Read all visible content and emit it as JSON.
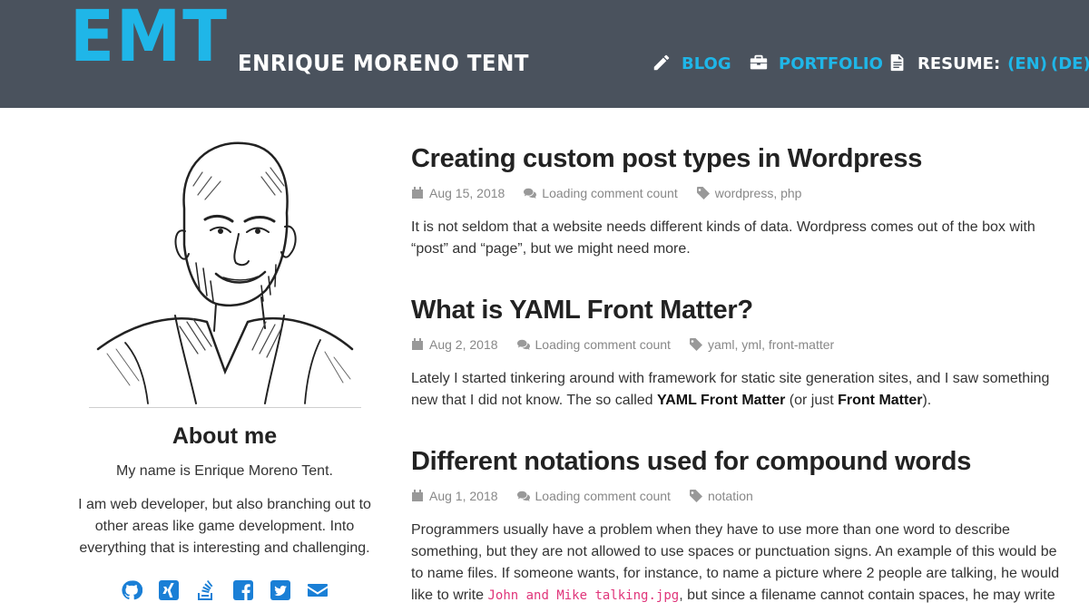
{
  "header": {
    "logo": "EMT",
    "site_name": "ENRIQUE MORENO TENT",
    "nav": {
      "blog": "BLOG",
      "portfolio": "PORTFOLIO",
      "resume_label": "RESUME:",
      "resume_en": "(EN)",
      "resume_de": "(DE)"
    }
  },
  "colors": {
    "header_bg": "#4a525d",
    "accent": "#1fb6e8",
    "social": "#1a7fd6",
    "code": "#e0357a"
  },
  "sidebar": {
    "about_title": "About me",
    "about_p1": "My name is Enrique Moreno Tent.",
    "about_p2": "I am web developer, but also branching out to other areas like game development. Into everything that is interesting and challenging.",
    "social_icons": [
      "github-icon",
      "xing-icon",
      "stackoverflow-icon",
      "facebook-icon",
      "twitter-icon",
      "email-icon"
    ]
  },
  "posts": [
    {
      "title": "Creating custom post types in Wordpress",
      "date": "Aug 15, 2018",
      "comments": "Loading comment count",
      "tags": "wordpress, php",
      "excerpt": "It is not seldom that a website needs different kinds of data. Wordpress comes out of the box with “post” and “page”, but we might need more."
    },
    {
      "title": "What is YAML Front Matter?",
      "date": "Aug 2, 2018",
      "comments": "Loading comment count",
      "tags": "yaml, yml, front-matter",
      "excerpt_a": "Lately I started tinkering around with framework for static site generation sites, and I saw something new that I did not know. The so called ",
      "excerpt_strong1": "YAML Front Matter",
      "excerpt_b": " (or just ",
      "excerpt_strong2": "Front Matter",
      "excerpt_c": ")."
    },
    {
      "title": "Different notations used for compound words",
      "date": "Aug 1, 2018",
      "comments": "Loading comment count",
      "tags": "notation",
      "excerpt_a": "Programmers usually have a problem when they have to use more than one word to describe something, but they are not allowed to use spaces or punctuation signs. An example of this would be to name files. If someone wants, for instance, to name a picture where 2 people are talking, he would like to write ",
      "excerpt_code": "John and Mike talking.jpg",
      "excerpt_b": ", but since a filename cannot contain spaces, he may write"
    }
  ]
}
